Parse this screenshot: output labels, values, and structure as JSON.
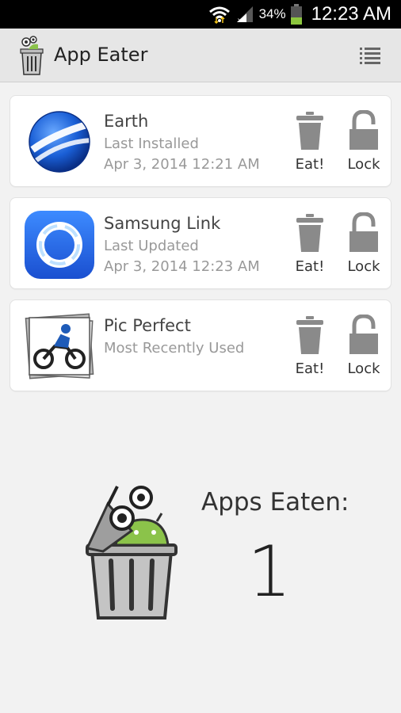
{
  "status_bar": {
    "battery_percent": "34%",
    "time": "12:23 AM"
  },
  "header": {
    "title": "App Eater",
    "menu_icon": "list-menu-icon"
  },
  "apps": [
    {
      "name": "Earth",
      "line1": "Last Installed",
      "line2": "Apr 3, 2014 12:21 AM",
      "icon": "google-earth-icon",
      "eat_label": "Eat!",
      "lock_label": "Lock"
    },
    {
      "name": "Samsung Link",
      "line1": "Last Updated",
      "line2": "Apr 3, 2014 12:23 AM",
      "icon": "samsung-link-icon",
      "eat_label": "Eat!",
      "lock_label": "Lock"
    },
    {
      "name": "Pic Perfect",
      "line1": "Most Recently Used",
      "line2": "",
      "icon": "pic-perfect-icon",
      "eat_label": "Eat!",
      "lock_label": "Lock"
    }
  ],
  "summary": {
    "label": "Apps Eaten:",
    "count": "1"
  },
  "colors": {
    "header_bg": "#e6e6e6",
    "card_bg": "#ffffff",
    "action_icon": "#8a8a8a",
    "android_green": "#8bc34a"
  }
}
